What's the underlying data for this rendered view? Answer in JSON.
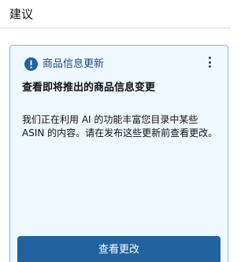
{
  "header": {
    "title": "建议"
  },
  "card": {
    "tag": "商品信息更新",
    "tag_icon": "info-icon",
    "menu_icon": "more-vertical-icon",
    "title": "查看即将推出的商品信息变更",
    "body": "我们正在利用 AI 的功能丰富您目录中某些 ASIN 的内容。请在发布这些更新前查看更改。",
    "button_label": "查看更改"
  },
  "colors": {
    "card_background": "#f0f8ff",
    "card_border": "#7fb8e6",
    "accent_blue": "#2162a1",
    "tag_text": "#0f4b8c"
  }
}
